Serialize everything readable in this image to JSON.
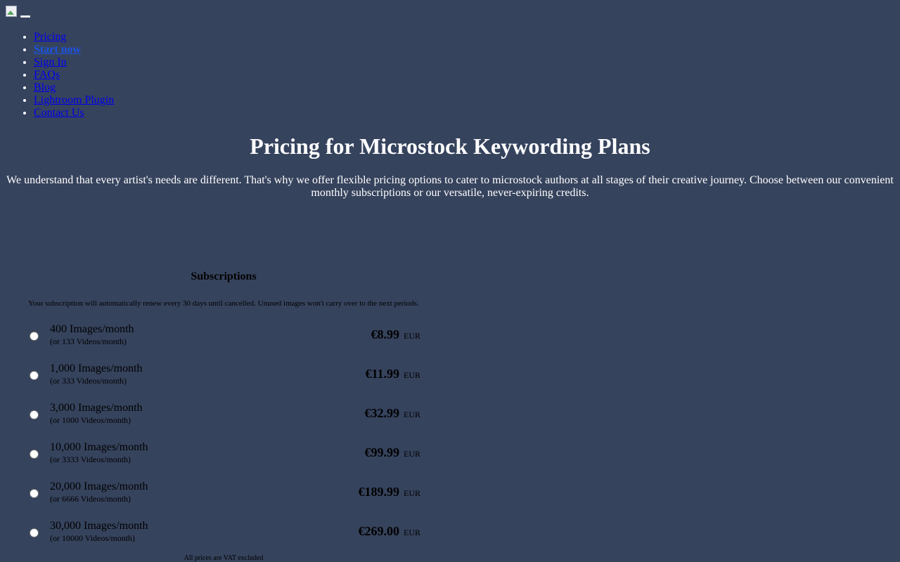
{
  "header": {
    "menu_toggle_label": ""
  },
  "nav": {
    "items": [
      {
        "label": "Pricing"
      },
      {
        "label": "Start now"
      },
      {
        "label": "Sign In"
      },
      {
        "label": "FAQs"
      },
      {
        "label": "Blog"
      },
      {
        "label": "Lightroom Plugin"
      },
      {
        "label": "Contact Us"
      }
    ]
  },
  "hero": {
    "title": "Pricing for Microstock Keywording Plans",
    "subtitle": "We understand that every artist's needs are different. That's why we offer flexible pricing options to cater to microstock authors at all stages of their creative journey. Choose between our convenient monthly subscriptions or our versatile, never-expiring credits."
  },
  "subscriptions": {
    "title": "Subscriptions",
    "note": "Your subscription will automatically renew every 30 days until cancelled. Unused images won't carry over to the next periods.",
    "plans": [
      {
        "name": "400 Images/month",
        "alt": "(or 133 Videos/month)",
        "price": "€8.99",
        "currency": "EUR"
      },
      {
        "name": "1,000 Images/month",
        "alt": "(or 333 Videos/month)",
        "price": "€11.99",
        "currency": "EUR"
      },
      {
        "name": "3,000 Images/month",
        "alt": "(or 1000 Videos/month)",
        "price": "€32.99",
        "currency": "EUR"
      },
      {
        "name": "10,000 Images/month",
        "alt": "(or 3333 Videos/month)",
        "price": "€99.99",
        "currency": "EUR"
      },
      {
        "name": "20,000 Images/month",
        "alt": "(or 6666 Videos/month)",
        "price": "€189.99",
        "currency": "EUR"
      },
      {
        "name": "30,000 Images/month",
        "alt": "(or 10000 Videos/month)",
        "price": "€269.00",
        "currency": "EUR"
      }
    ],
    "vat_note": "All prices are VAT excluded"
  },
  "colors": {
    "background": "#36435d",
    "link": "#0000ee",
    "active_link": "#1a55e8"
  }
}
